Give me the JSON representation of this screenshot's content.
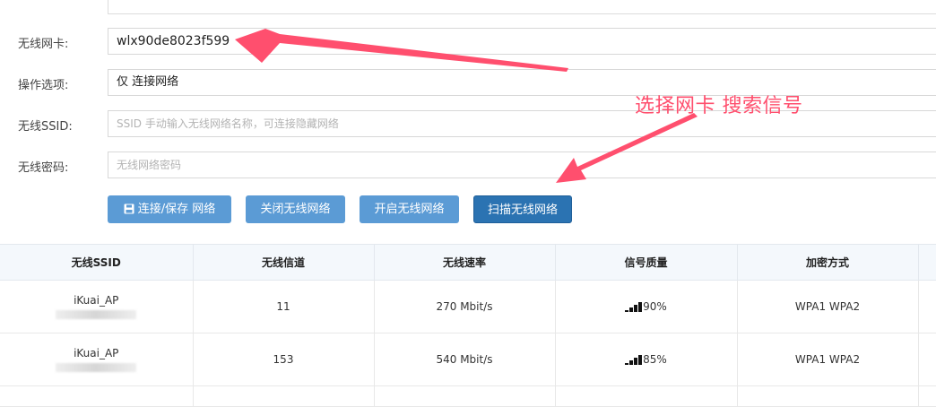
{
  "form": {
    "nic_label": "无线网卡:",
    "nic_value": "wlx90de8023f599",
    "op_label": "操作选项:",
    "op_value": "仅 连接网络",
    "ssid_label": "无线SSID:",
    "ssid_placeholder": "SSID 手动输入无线网络名称，可连接隐藏网络",
    "pwd_label": "无线密码:",
    "pwd_placeholder": "无线网络密码"
  },
  "buttons": {
    "connect_save": "连接/保存 网络",
    "close_wireless": "关闭无线网络",
    "open_wireless": "开启无线网络",
    "scan_wireless": "扫描无线网络"
  },
  "annotation": {
    "text": "选择网卡 搜索信号",
    "color": "#ff4f6e"
  },
  "table": {
    "headers": [
      "无线SSID",
      "无线信道",
      "无线速率",
      "信号质量",
      "加密方式"
    ],
    "rows": [
      {
        "ssid": "iKuai_AP",
        "channel": "11",
        "rate": "270 Mbit/s",
        "signal": "90%",
        "encryption": "WPA1 WPA2"
      },
      {
        "ssid": "iKuai_AP",
        "channel": "153",
        "rate": "540 Mbit/s",
        "signal": "85%",
        "encryption": "WPA1 WPA2"
      }
    ]
  },
  "colors": {
    "button_primary": "#5b9bd5",
    "button_active": "#2b73b2",
    "header_bg": "#f4f8fc"
  }
}
